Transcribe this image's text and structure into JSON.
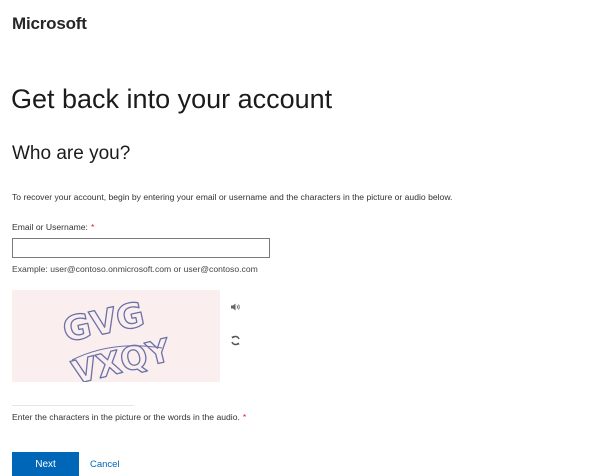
{
  "brand": {
    "name": "Microsoft"
  },
  "header": {
    "title": "Get back into your account",
    "subtitle": "Who are you?"
  },
  "intro_text": "To recover your account, begin by entering your email or username and the characters in the picture or audio below.",
  "email": {
    "label": "Email or Username:",
    "required_mark": "*",
    "value": "",
    "placeholder": "",
    "example": "Example: user@contoso.onmicrosoft.com or user@contoso.com"
  },
  "captcha": {
    "image_text": [
      "GVG",
      "VXQY"
    ],
    "audio_icon": "speaker-icon",
    "refresh_icon": "refresh-icon",
    "input_value": "",
    "label": "Enter the characters in the picture or the words in the audio.",
    "required_mark": "*",
    "background_color": "#fbeeee",
    "glyph_color": "#6a72a8"
  },
  "actions": {
    "next_label": "Next",
    "cancel_label": "Cancel"
  },
  "colors": {
    "accent": "#0067b8",
    "required": "#e81123"
  }
}
